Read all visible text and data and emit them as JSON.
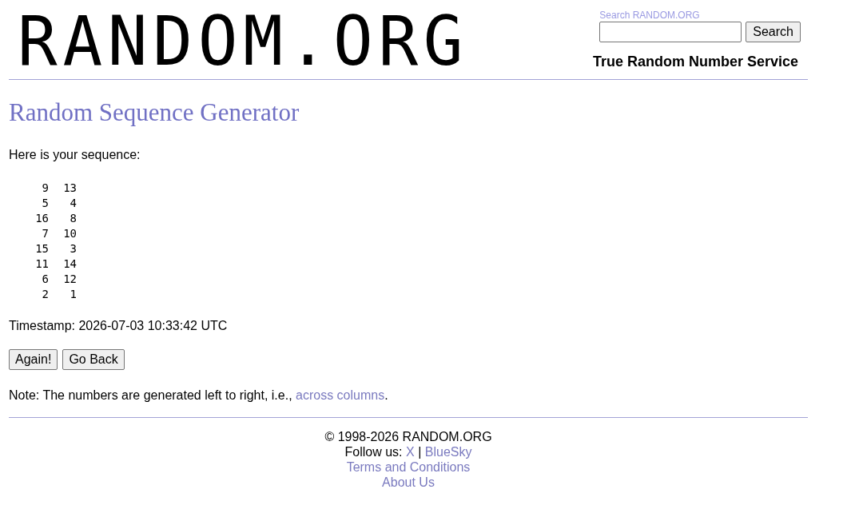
{
  "header": {
    "logo": "RANDOM.ORG",
    "search": {
      "label": "Search RANDOM.ORG",
      "button": "Search"
    },
    "tagline": "True Random Number Service"
  },
  "title": "Random Sequence Generator",
  "intro": "Here is your sequence:",
  "sequence": {
    "rows": [
      [
        "9",
        "13"
      ],
      [
        "5",
        "4"
      ],
      [
        "16",
        "8"
      ],
      [
        "7",
        "10"
      ],
      [
        "15",
        "3"
      ],
      [
        "11",
        "14"
      ],
      [
        "6",
        "12"
      ],
      [
        "2",
        "1"
      ]
    ]
  },
  "timestamp": "Timestamp: 2026-07-03 10:33:42 UTC",
  "buttons": [
    "Again!",
    "Go Back"
  ],
  "note": {
    "text": "Note: The numbers are generated left to right, i.e.,",
    "link": "across columns",
    "end": "."
  },
  "footer": {
    "copyright": "© 1998-2026 RANDOM.ORG",
    "follow_label": "Follow us:",
    "social_links": [
      "X",
      "BlueSky"
    ],
    "separator": "|",
    "links": [
      "Terms and Conditions",
      "About Us"
    ]
  }
}
